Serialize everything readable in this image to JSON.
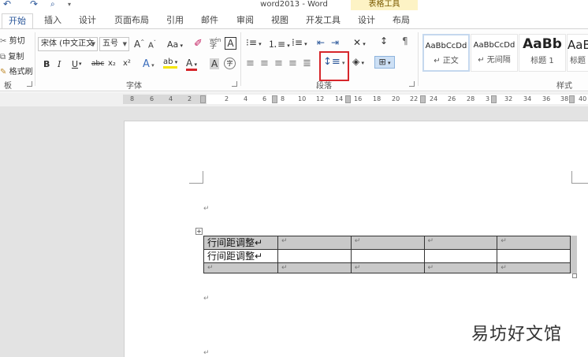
{
  "window": {
    "title": "word2013 - Word",
    "context_header": "表格工具"
  },
  "tabs": [
    {
      "label": "开始",
      "active": true
    },
    {
      "label": "插入"
    },
    {
      "label": "设计"
    },
    {
      "label": "页面布局"
    },
    {
      "label": "引用"
    },
    {
      "label": "邮件"
    },
    {
      "label": "审阅"
    },
    {
      "label": "视图"
    },
    {
      "label": "开发工具"
    },
    {
      "label": "设计"
    },
    {
      "label": "布局"
    }
  ],
  "clipboard": {
    "cut": "剪切",
    "copy": "复制",
    "format_painter": "格式刷",
    "group_label": "板"
  },
  "font": {
    "name": "宋体 (中文正文",
    "size": "五号",
    "group_label": "字体",
    "bold": "B",
    "italic": "I",
    "underline": "U",
    "strike": "abc",
    "subscript": "x₂",
    "superscript": "x²",
    "grow": "A",
    "shrink": "A",
    "case": "Aa",
    "text_effect": "A",
    "highlight": "ab",
    "font_color": "A",
    "char_shade": "A",
    "enclose": "字",
    "phonetic": "wén",
    "border": "A"
  },
  "paragraph": {
    "group_label": "段落"
  },
  "styles": {
    "group_label": "样式",
    "items": [
      {
        "sample": "AaBbCcDd",
        "name": "↵ 正文"
      },
      {
        "sample": "AaBbCcDd",
        "name": "↵ 无间隔"
      },
      {
        "sample": "AaBb",
        "name": "标题 1"
      },
      {
        "sample": "AaB",
        "name": "标题"
      }
    ]
  },
  "ruler": {
    "numbers": [
      "8",
      "6",
      "4",
      "2",
      "2",
      "4",
      "6",
      "8",
      "10",
      "12",
      "14",
      "16",
      "18",
      "20",
      "22",
      "24",
      "26",
      "28",
      "3",
      "32",
      "34",
      "36",
      "38",
      "40"
    ]
  },
  "document": {
    "para_mark": "↵",
    "table": {
      "rows": [
        [
          "行间距调整↵",
          "↵",
          "↵",
          "↵",
          "↵"
        ],
        [
          "行间距调整↵",
          "",
          "",
          "",
          ""
        ],
        [
          "↵",
          "↵",
          "↵",
          "↵",
          "↵"
        ]
      ]
    }
  },
  "watermark": "易坊好文馆",
  "colors": {
    "accent": "#2b579a",
    "highlight_box": "#d6262b",
    "context_tab": "#fdf3c5",
    "table_shade": "#c9c9c9"
  }
}
